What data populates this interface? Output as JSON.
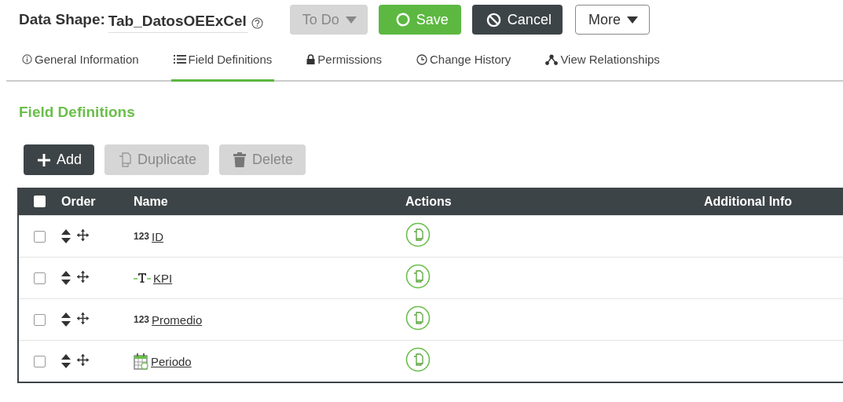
{
  "header": {
    "label": "Data Shape:",
    "name": "Tab_DatosOEExCel",
    "buttons": [
      {
        "label": "To Do",
        "kind": "state"
      },
      {
        "label": "Save",
        "kind": "save"
      },
      {
        "label": "Cancel",
        "kind": "cancel"
      },
      {
        "label": "More",
        "kind": "more"
      }
    ]
  },
  "tabs": [
    {
      "label": "General Information",
      "kind": "info",
      "selected": false
    },
    {
      "label": "Field Definitions",
      "kind": "list",
      "selected": true
    },
    {
      "label": "Permissions",
      "kind": "lock",
      "selected": false
    },
    {
      "label": "Change History",
      "kind": "clock",
      "selected": false
    },
    {
      "label": "View Relationships",
      "kind": "network",
      "selected": false
    }
  ],
  "section": {
    "title": "Field Definitions"
  },
  "toolbar": [
    {
      "label": "Add",
      "kind": "add",
      "disabled": false
    },
    {
      "label": "Duplicate",
      "kind": "duplicate",
      "disabled": true
    },
    {
      "label": "Delete",
      "kind": "delete",
      "disabled": true
    }
  ],
  "table": {
    "columns": [
      "Order",
      "Name",
      "Actions",
      "Additional Info"
    ],
    "all_checked": false,
    "rows": [
      {
        "checked": false,
        "kind": "number",
        "type_text": "123",
        "name": "ID"
      },
      {
        "checked": false,
        "kind": "text",
        "name": "KPI"
      },
      {
        "checked": false,
        "kind": "number",
        "type_text": "123",
        "name": "Promedio"
      },
      {
        "checked": false,
        "kind": "date",
        "name": "Periodo"
      }
    ]
  }
}
